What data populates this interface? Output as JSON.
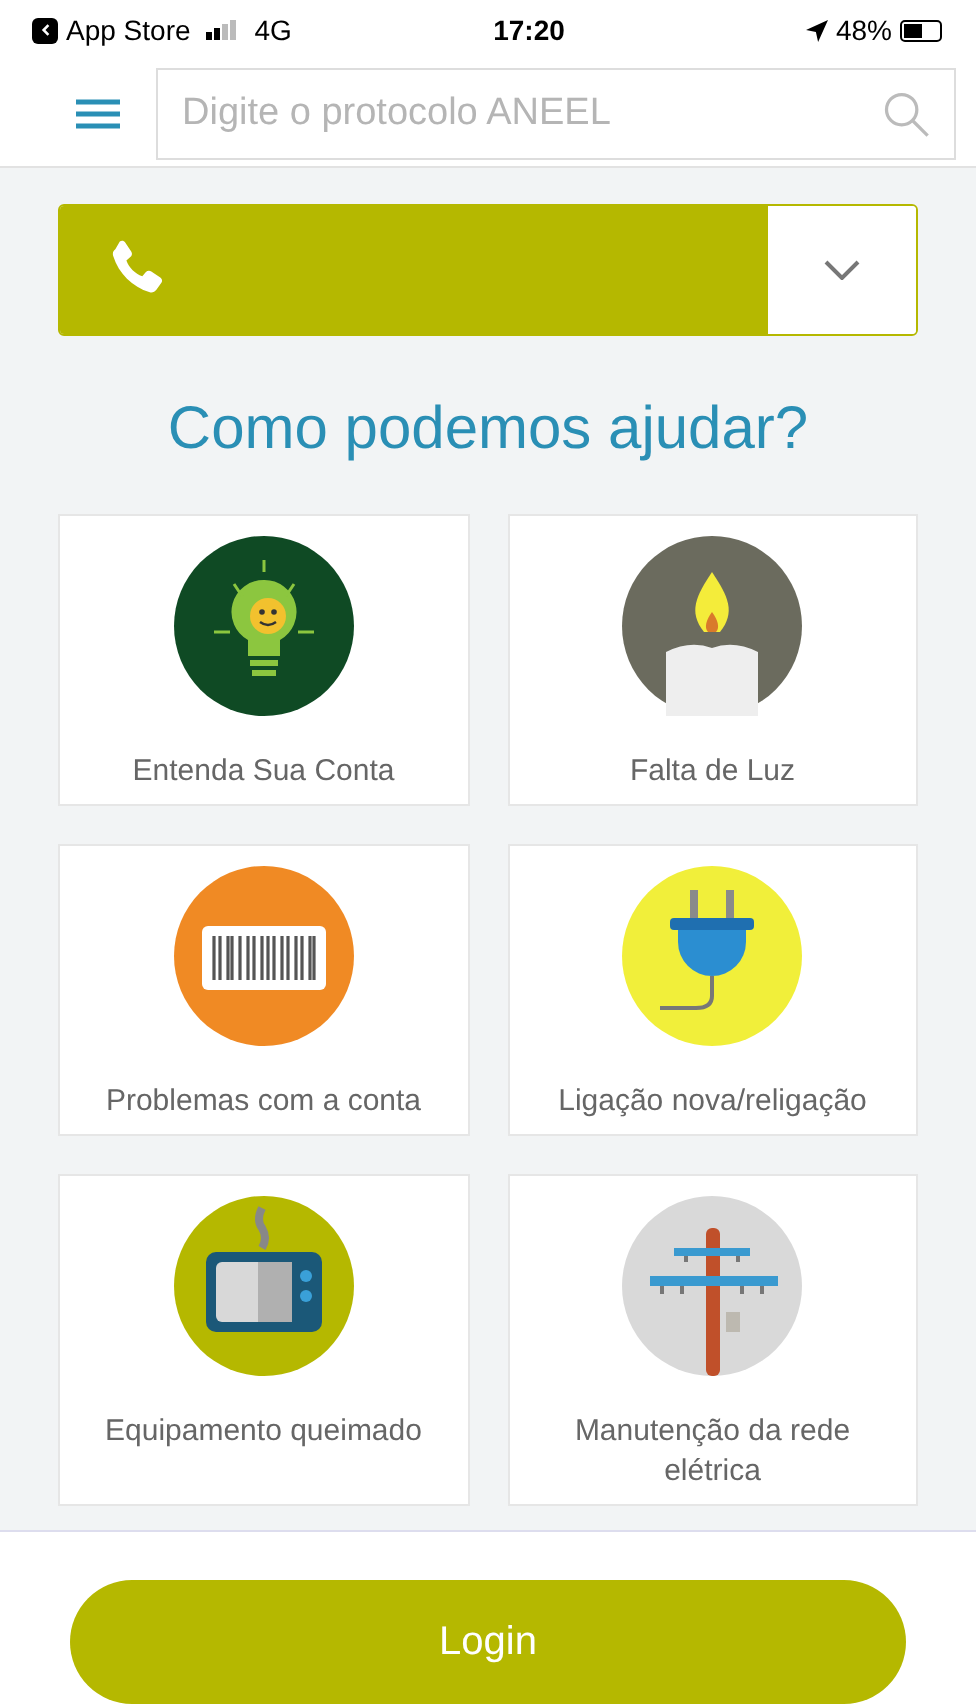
{
  "status_bar": {
    "back_label": "App Store",
    "network": "4G",
    "time": "17:20",
    "battery": "48%"
  },
  "search": {
    "placeholder": "Digite o protocolo ANEEL"
  },
  "title": "Como podemos ajudar?",
  "tiles": [
    {
      "kind": "bulb",
      "label": "Entenda Sua Conta"
    },
    {
      "kind": "candle",
      "label": "Falta de Luz"
    },
    {
      "kind": "barcode",
      "label": "Problemas com a conta"
    },
    {
      "kind": "plug",
      "label": "Ligação nova/religação"
    },
    {
      "kind": "tv",
      "label": "Equipamento queimado"
    },
    {
      "kind": "pole",
      "label": "Manutenção da rede elétrica"
    }
  ],
  "login_button": "Login"
}
